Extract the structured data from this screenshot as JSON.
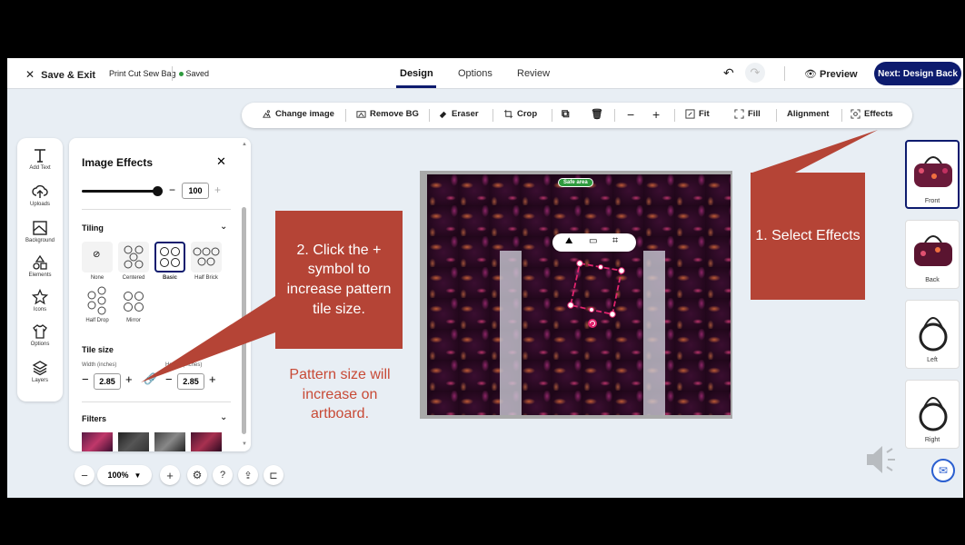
{
  "header": {
    "save_exit": "Save & Exit",
    "product": "Print Cut Sew Bag",
    "saved": "Saved",
    "tabs": [
      "Design",
      "Options",
      "Review"
    ],
    "preview": "Preview",
    "next": "Next: Design Back"
  },
  "toolbar": {
    "change_image": "Change image",
    "remove_bg": "Remove BG",
    "eraser": "Eraser",
    "crop": "Crop",
    "fit": "Fit",
    "fill": "Fill",
    "alignment": "Alignment",
    "effects": "Effects"
  },
  "leftnav": {
    "items": [
      "Add Text",
      "Uploads",
      "Background",
      "Elements",
      "Icons",
      "Options",
      "Layers"
    ]
  },
  "panel": {
    "title": "Image Effects",
    "slider_value": "100",
    "tiling_title": "Tiling",
    "tiling_options": [
      "None",
      "Centered",
      "Basic",
      "Half Brick",
      "Half Drop",
      "Mirror"
    ],
    "tiling_selected": "Basic",
    "tile_size_title": "Tile size",
    "width_label": "Width (inches)",
    "height_label": "Height (inches)",
    "width_value": "2.85",
    "height_value": "2.85",
    "filters_title": "Filters"
  },
  "canvas": {
    "safe_area": "Safe area"
  },
  "thumbnails": [
    "Front",
    "Back",
    "Left",
    "Right"
  ],
  "zoom": {
    "level": "100%"
  },
  "annotations": {
    "callout_1": "1. Select Effects",
    "callout_2": "2. Click the + symbol to increase pattern tile size.",
    "note": "Pattern size will increase on artboard."
  },
  "colors": {
    "brand": "#0d1b6e",
    "callout": "#b54436",
    "saved_dot": "#2e9a3e",
    "pattern_base": "#3a0e30"
  }
}
